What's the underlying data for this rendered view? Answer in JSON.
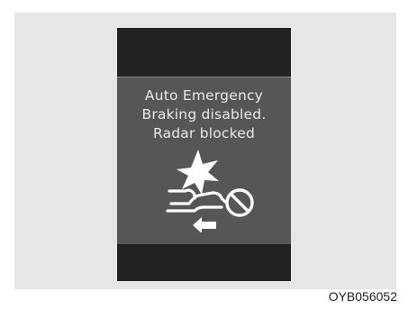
{
  "display": {
    "message_lines": [
      "Auto Emergency",
      "Braking disabled.",
      "Radar blocked"
    ],
    "icon": "aeb-radar-blocked-icon",
    "colors": {
      "panel_background": "#565656",
      "band_background": "#222222",
      "text": "#e9e9e9",
      "icon": "#ffffff"
    }
  },
  "figure": {
    "code": "OYB056052"
  }
}
